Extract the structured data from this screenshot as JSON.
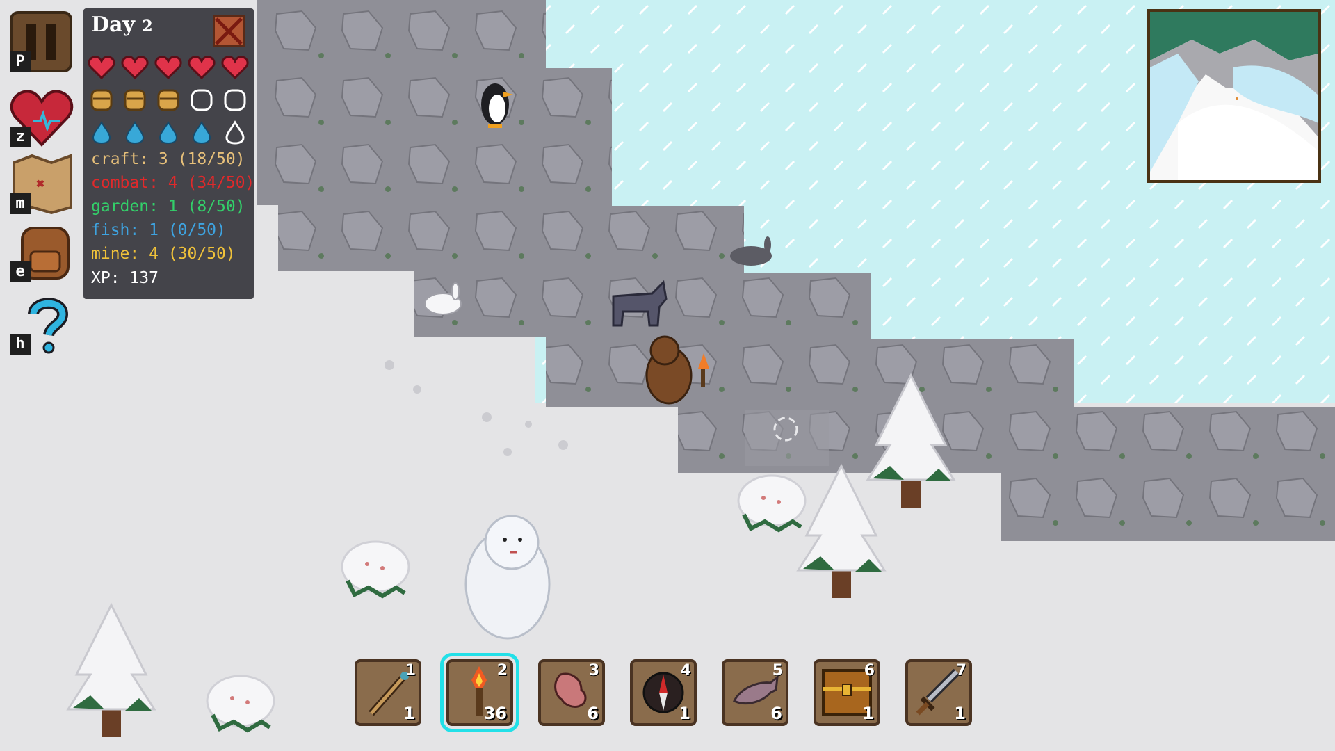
{
  "colors": {
    "snow": "#e4e4e6",
    "ice_water": "#c9f1f3",
    "rock": "#8e8e96",
    "craft": "#e7c07a",
    "combat": "#e0292b",
    "garden": "#33cf6a",
    "fish": "#3ea3e0",
    "mine": "#f0c23a",
    "xp": "#ffffff",
    "slot_selected": "#22e0e8"
  },
  "sidebar": {
    "buttons": [
      {
        "name": "pause",
        "key": "P",
        "icon": "pause-icon"
      },
      {
        "name": "health",
        "key": "z",
        "icon": "heart-pulse-icon"
      },
      {
        "name": "map",
        "key": "m",
        "icon": "map-icon"
      },
      {
        "name": "inventory",
        "key": "e",
        "icon": "backpack-icon"
      },
      {
        "name": "help",
        "key": "h",
        "icon": "question-icon"
      }
    ]
  },
  "stats": {
    "day_label": "Day",
    "day_number": "2",
    "health": {
      "current": 5,
      "max": 5
    },
    "hunger": {
      "current": 3,
      "max": 5
    },
    "thirst": {
      "current": 4,
      "max": 5
    },
    "skills": {
      "craft": "craft: 3 (18/50)",
      "combat": "combat: 4 (34/50)",
      "garden": "garden: 1 (8/50)",
      "fish": "fish: 1 (0/50)",
      "mine": "mine: 4 (30/50)"
    },
    "xp": "XP: 137"
  },
  "hotbar": {
    "selected_slot": 2,
    "slots": [
      {
        "num": "1",
        "count": "1",
        "icon": "wooden-staff-icon"
      },
      {
        "num": "2",
        "count": "36",
        "icon": "torch-icon"
      },
      {
        "num": "3",
        "count": "6",
        "icon": "raw-meat-icon"
      },
      {
        "num": "4",
        "count": "1",
        "icon": "compass-icon"
      },
      {
        "num": "5",
        "count": "6",
        "icon": "fish-icon"
      },
      {
        "num": "6",
        "count": "1",
        "icon": "chest-icon"
      },
      {
        "num": "7",
        "count": "1",
        "icon": "sword-icon"
      }
    ]
  }
}
